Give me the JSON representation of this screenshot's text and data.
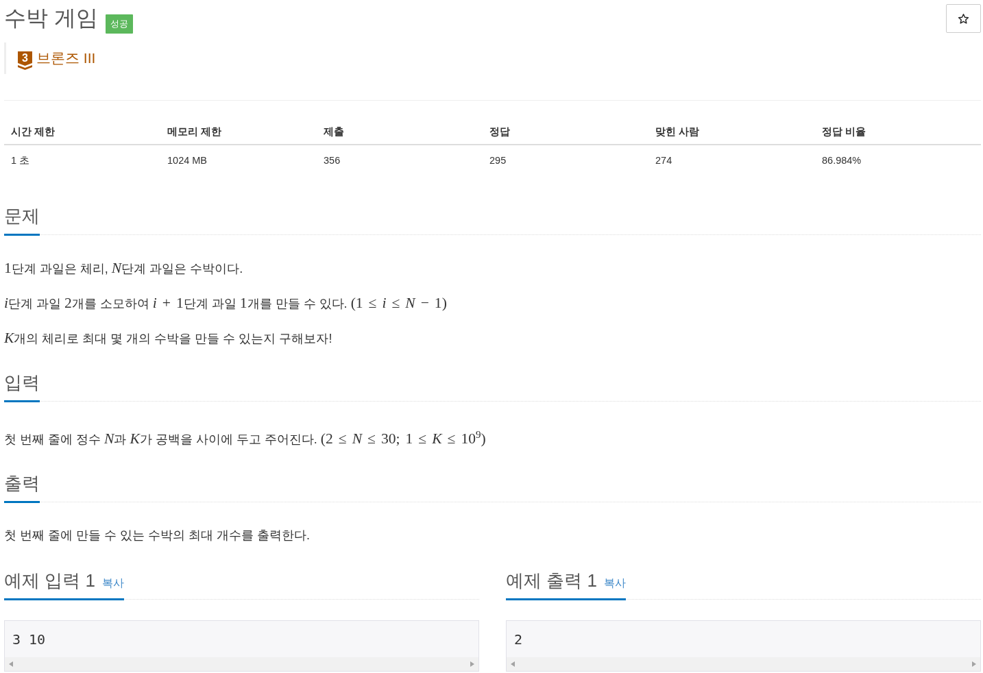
{
  "problem": {
    "title": "수박 게임",
    "status_badge": "성공",
    "star_button": {
      "starred": false
    }
  },
  "tier": {
    "number": "3",
    "name": "브론즈 III"
  },
  "stats_table": {
    "columns": [
      "시간 제한",
      "메모리 제한",
      "제출",
      "정답",
      "맞힌 사람",
      "정답 비율"
    ],
    "rows": [
      [
        "1 초",
        "1024 MB",
        "356",
        "295",
        "274",
        "86.984%"
      ]
    ]
  },
  "sections": [
    {
      "heading": "문제",
      "paragraphs": [
        [
          {
            "kind": "math",
            "text": "1"
          },
          {
            "kind": "text",
            "text": "단계 과일은 체리, "
          },
          {
            "kind": "math",
            "text": "*N*"
          },
          {
            "kind": "text",
            "text": "단계 과일은 수박이다."
          }
        ],
        [
          {
            "kind": "math",
            "text": "*i*"
          },
          {
            "kind": "text",
            "text": "단계 과일 "
          },
          {
            "kind": "math",
            "text": "2"
          },
          {
            "kind": "text",
            "text": "개를 소모하여 "
          },
          {
            "kind": "math",
            "text": "*i* + 1"
          },
          {
            "kind": "text",
            "text": "단계 과일 "
          },
          {
            "kind": "math",
            "text": "1"
          },
          {
            "kind": "text",
            "text": "개를 만들 수 있다. "
          },
          {
            "kind": "math",
            "text": "(1 ≤ *i* ≤ *N* − 1)"
          }
        ],
        [
          {
            "kind": "math",
            "text": "*K*"
          },
          {
            "kind": "text",
            "text": "개의 체리로 최대 몇 개의 수박을 만들 수 있는지 구해보자!"
          }
        ]
      ]
    },
    {
      "heading": "입력",
      "paragraphs": [
        [
          {
            "kind": "text",
            "text": "첫 번째 줄에 정수 "
          },
          {
            "kind": "math",
            "text": "*N*"
          },
          {
            "kind": "text",
            "text": "과 "
          },
          {
            "kind": "math",
            "text": "*K*"
          },
          {
            "kind": "text",
            "text": "가 공백을 사이에 두고 주어진다. "
          },
          {
            "kind": "math",
            "text": "(2 ≤ *N* ≤ 30; 1 ≤ *K* ≤ 10$^{9}$)"
          }
        ]
      ]
    },
    {
      "heading": "출력",
      "paragraphs": [
        [
          {
            "kind": "text",
            "text": "첫 번째 줄에 만들 수 있는 수박의 최대 개수를 출력한다."
          }
        ]
      ]
    }
  ],
  "samples": [
    {
      "heading": "예제 입력 1",
      "copy_link": "복사",
      "content": "3 10"
    },
    {
      "heading": "예제 출력 1",
      "copy_link": "복사",
      "content": "2"
    }
  ]
}
